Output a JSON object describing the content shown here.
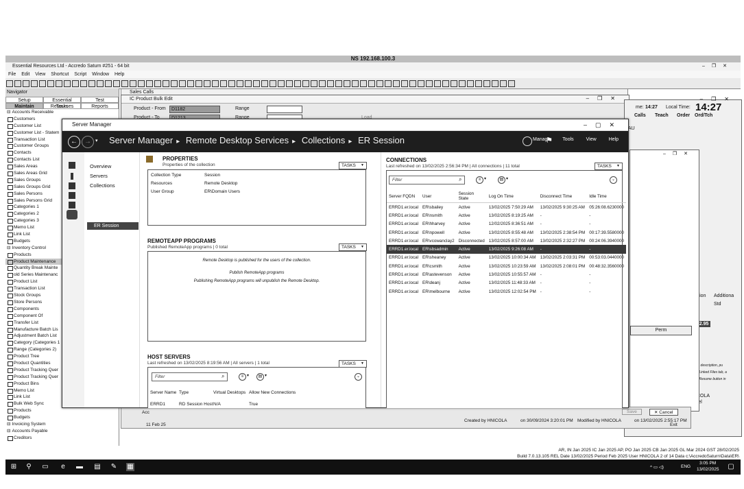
{
  "remote_title": "NS 192.168.100.3",
  "app": {
    "title": "Essential Resources Ltd - Accredo Saturn #251 - 64 bit",
    "menu": [
      "File",
      "Edit",
      "View",
      "Shortcut",
      "Script",
      "Window",
      "Help"
    ]
  },
  "navigator": {
    "header": "Navigator",
    "tabs_row1": [
      "Setup",
      "Essential Resources",
      "Test"
    ],
    "tabs_row2": [
      "Maintain",
      "Tasks",
      "Reports"
    ],
    "items": [
      {
        "label": "Accounts Receivable",
        "type": "section"
      },
      {
        "label": "Customers",
        "type": "item"
      },
      {
        "label": "Customer List",
        "type": "item"
      },
      {
        "label": "Customer List - Statem",
        "type": "item"
      },
      {
        "label": "Transaction List",
        "type": "item"
      },
      {
        "label": "Customer Groups",
        "type": "item"
      },
      {
        "label": "Contacts",
        "type": "item"
      },
      {
        "label": "Contacts List",
        "type": "item"
      },
      {
        "label": "Sales Areas",
        "type": "item"
      },
      {
        "label": "Sales Areas Grid",
        "type": "item"
      },
      {
        "label": "Sales Groups",
        "type": "item"
      },
      {
        "label": "Sales Groups Grid",
        "type": "item"
      },
      {
        "label": "Sales Persons",
        "type": "item"
      },
      {
        "label": "Sales Persons Grid",
        "type": "item"
      },
      {
        "label": "Categories 1",
        "type": "item"
      },
      {
        "label": "Categories 2",
        "type": "item"
      },
      {
        "label": "Categories 3",
        "type": "item"
      },
      {
        "label": "Memo List",
        "type": "item"
      },
      {
        "label": "Link List",
        "type": "item"
      },
      {
        "label": "Budgets",
        "type": "item"
      },
      {
        "label": "Inventory Control",
        "type": "section"
      },
      {
        "label": "Products",
        "type": "item"
      },
      {
        "label": "Product Maintenance",
        "type": "item",
        "highlight": true
      },
      {
        "label": "Quantity Break Mainte",
        "type": "item"
      },
      {
        "label": "old Series Maintenanc",
        "type": "item"
      },
      {
        "label": "Product List",
        "type": "item"
      },
      {
        "label": "Transaction List",
        "type": "item"
      },
      {
        "label": "Stock Groups",
        "type": "item"
      },
      {
        "label": "Store Persons",
        "type": "item"
      },
      {
        "label": "Components",
        "type": "item"
      },
      {
        "label": "Component Of",
        "type": "item"
      },
      {
        "label": "Transfer List",
        "type": "item"
      },
      {
        "label": "Manufacture Batch Lis",
        "type": "item"
      },
      {
        "label": "Adjustment Batch List",
        "type": "item"
      },
      {
        "label": "Category (Categories 1",
        "type": "item"
      },
      {
        "label": "Range (Categories 2)",
        "type": "item"
      },
      {
        "label": "Product Tree",
        "type": "item"
      },
      {
        "label": "Product Quantities",
        "type": "item"
      },
      {
        "label": "Product Tracking Quer",
        "type": "item"
      },
      {
        "label": "Product Tracking Quer",
        "type": "item"
      },
      {
        "label": "Product Bins",
        "type": "item"
      },
      {
        "label": "Memo List",
        "type": "item"
      },
      {
        "label": "Link List",
        "type": "item"
      },
      {
        "label": "Bulk Web Sync",
        "type": "item"
      },
      {
        "label": "Products",
        "type": "item"
      },
      {
        "label": "Budgets",
        "type": "item"
      },
      {
        "label": "Invoicing System",
        "type": "section"
      },
      {
        "label": "Accounts Payable",
        "type": "section"
      },
      {
        "label": "Creditors",
        "type": "item"
      }
    ]
  },
  "bulk_edit": {
    "title": "IC Product Bulk Edit",
    "sales_calls_title": "Sales Calls",
    "product_from_label": "Product - From",
    "product_from_value": "D1182",
    "product_to_label": "Product - To",
    "product_to_value": "D1213",
    "range_label": "Range",
    "load_label": "Load"
  },
  "right_window": {
    "time_label": "me:",
    "time_value": "14:27",
    "local_time_label": "Local Time:",
    "local_time_value": "14:27",
    "cols": [
      "Calls",
      "Teach",
      "Order",
      "Ord/Tch"
    ],
    "au": "AU",
    "direction": "direction",
    "additional": "Additiona",
    "d": "d",
    "std": "Std",
    "price": "$22.95",
    "perm": "Perm",
    "hint1": "title, description, pu",
    "hint2": "the Linked Files tab, a",
    "hint3": "the Resume button in",
    "nicola": "NICOLA",
    "ncer": "ncel",
    "pm": "PM"
  },
  "server_manager": {
    "window_title": "Server Manager",
    "breadcrumb": [
      "Server Manager",
      "Remote Desktop Services",
      "Collections",
      "ER Session"
    ],
    "menu": [
      "Manage",
      "Tools",
      "View",
      "Help"
    ],
    "nav": [
      "Overview",
      "Servers",
      "Collections",
      "ER Session"
    ],
    "properties": {
      "title": "PROPERTIES",
      "subtitle": "Properties of the collection",
      "tasks": "TASKS",
      "rows": [
        {
          "key": "Collection Type",
          "value": "Session"
        },
        {
          "key": "Resources",
          "value": "Remote Desktop"
        },
        {
          "key": "User Group",
          "value": "ER\\Domain Users"
        }
      ]
    },
    "remoteapp": {
      "title": "REMOTEAPP PROGRAMS",
      "subtitle": "Published RemoteApp programs | 0 total",
      "tasks": "TASKS",
      "line1": "Remote Desktop is published for the users of the collection.",
      "line2": "Publish RemoteApp programs",
      "line3": "Publishing RemoteApp programs will unpublish the Remote Desktop."
    },
    "host_servers": {
      "title": "HOST SERVERS",
      "subtitle": "Last refreshed on 13/02/2025 8:19:56 AM | All servers | 1 total",
      "tasks": "TASKS",
      "filter_placeholder": "Filter",
      "columns": [
        "Server Name",
        "Type",
        "Virtual Desktops",
        "Allow New Connections"
      ],
      "rows": [
        [
          "ERRD1",
          "RD Session Host",
          "N/A",
          "True"
        ]
      ]
    },
    "connections": {
      "title": "CONNECTIONS",
      "subtitle": "Last refreshed on 13/02/2025 2:56:34 PM | All connections | 11 total",
      "tasks": "TASKS",
      "filter_placeholder": "Filter",
      "columns": [
        "Server FQDN",
        "User",
        "Session State",
        "Log On Time",
        "Disconnect Time",
        "Idle Time"
      ],
      "rows": [
        [
          "ERRD1.er.local",
          "ER\\sbailey",
          "Active",
          "13/02/2025 7:50:29 AM",
          "13/02/2025 9:30:25 AM",
          "05:26:08.6230000"
        ],
        [
          "ERRD1.er.local",
          "ER\\nsmith",
          "Active",
          "13/02/2025 8:19:25 AM",
          "-",
          "-"
        ],
        [
          "ERRD1.er.local",
          "ER\\hharvey",
          "Active",
          "12/02/2025 8:36:51 AM",
          "-",
          "-"
        ],
        [
          "ERRD1.er.local",
          "ER\\npowell",
          "Active",
          "13/02/2025 8:55:48 AM",
          "13/02/2025 2:38:54 PM",
          "00:17:39.5580000"
        ],
        [
          "ERRD1.er.local",
          "ER\\vcowanclay2",
          "Disconnected",
          "13/02/2025 8:57:00 AM",
          "13/02/2025 2:32:27 PM",
          "00:24:06.3940000"
        ],
        [
          "ERRD1.er.local",
          "ER\\sbsadmin",
          "Active",
          "13/02/2025 9:26:08 AM",
          "-",
          "-"
        ],
        [
          "ERRD1.er.local",
          "ER\\sheaney",
          "Active",
          "13/02/2025 10:00:34 AM",
          "13/02/2025 2:03:31 PM",
          "00:53:03.0440000"
        ],
        [
          "ERRD1.er.local",
          "ER\\csmith",
          "Active",
          "13/02/2025 10:23:59 AM",
          "13/02/2025 2:08:01 PM",
          "00:48:32.3560000"
        ],
        [
          "ERRD1.er.local",
          "ER\\astevenson",
          "Active",
          "13/02/2025 10:55:57 AM",
          "-",
          "-"
        ],
        [
          "ERRD1.er.local",
          "ER\\deanj",
          "Active",
          "13/02/2025 11:48:33 AM",
          "-",
          "-"
        ],
        [
          "ERRD1.er.local",
          "ER\\melbourne",
          "Active",
          "13/02/2025 12:02:54 PM",
          "-",
          "-"
        ]
      ],
      "selected_row": 5
    }
  },
  "bottom": {
    "created_by": "Created by HNICOLA",
    "created_on": "on 30/09/2024 3:20:01 PM",
    "modified_by": "Modified by HNICOLA",
    "modified_on": "on 13/02/2025 2:55:17 PM",
    "save": "Save",
    "cancel": "Cancel",
    "exit": "Exit",
    "acc": "Acc",
    "feb": "11 Feb 25",
    "status1": "AR, IN Jan 2025   IC Jan 2025   AP, PO Jan 2025   CB Jan 2025   GL Mar 2024   GST 28/02/2025",
    "status2": "Build 7.0.13.105 REL   Date 13/02/2025   Period Feb 2025   User HNICOLA   2 of 14   Data c:\\AccredoSaturn\\Data\\ER\\"
  },
  "taskbar": {
    "time": "3:05 PM",
    "date": "13/02/2025",
    "lang": "ENG"
  }
}
